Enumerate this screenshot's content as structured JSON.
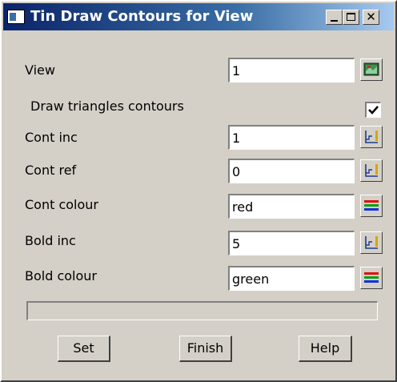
{
  "window": {
    "title": "Tin Draw Contours for View",
    "icon": "app-window-icon",
    "controls": {
      "minimize": "minimize-icon",
      "maximize": "maximize-icon",
      "close_label": "✕"
    }
  },
  "form": {
    "view": {
      "label": "View",
      "value": "1",
      "button_icon": "view-picker-icon"
    },
    "draw_triangles": {
      "label": "Draw triangles contours",
      "checked": true
    },
    "cont_inc": {
      "label": "Cont inc",
      "value": "1",
      "button_icon": "value-picker-icon"
    },
    "cont_ref": {
      "label": "Cont ref",
      "value": "0",
      "button_icon": "value-picker-icon"
    },
    "cont_colour": {
      "label": "Cont colour",
      "value": "red",
      "button_icon": "colour-list-icon"
    },
    "bold_inc": {
      "label": "Bold inc",
      "value": "5",
      "button_icon": "value-picker-icon"
    },
    "bold_colour": {
      "label": "Bold colour",
      "value": "green",
      "button_icon": "colour-list-icon"
    }
  },
  "status": {
    "text": ""
  },
  "buttons": {
    "set": "Set",
    "finish": "Finish",
    "help": "Help"
  },
  "colors": {
    "titlebar_start": "#0a246a",
    "titlebar_end": "#a6caf0",
    "dialog_bg": "#d4d0c8"
  }
}
